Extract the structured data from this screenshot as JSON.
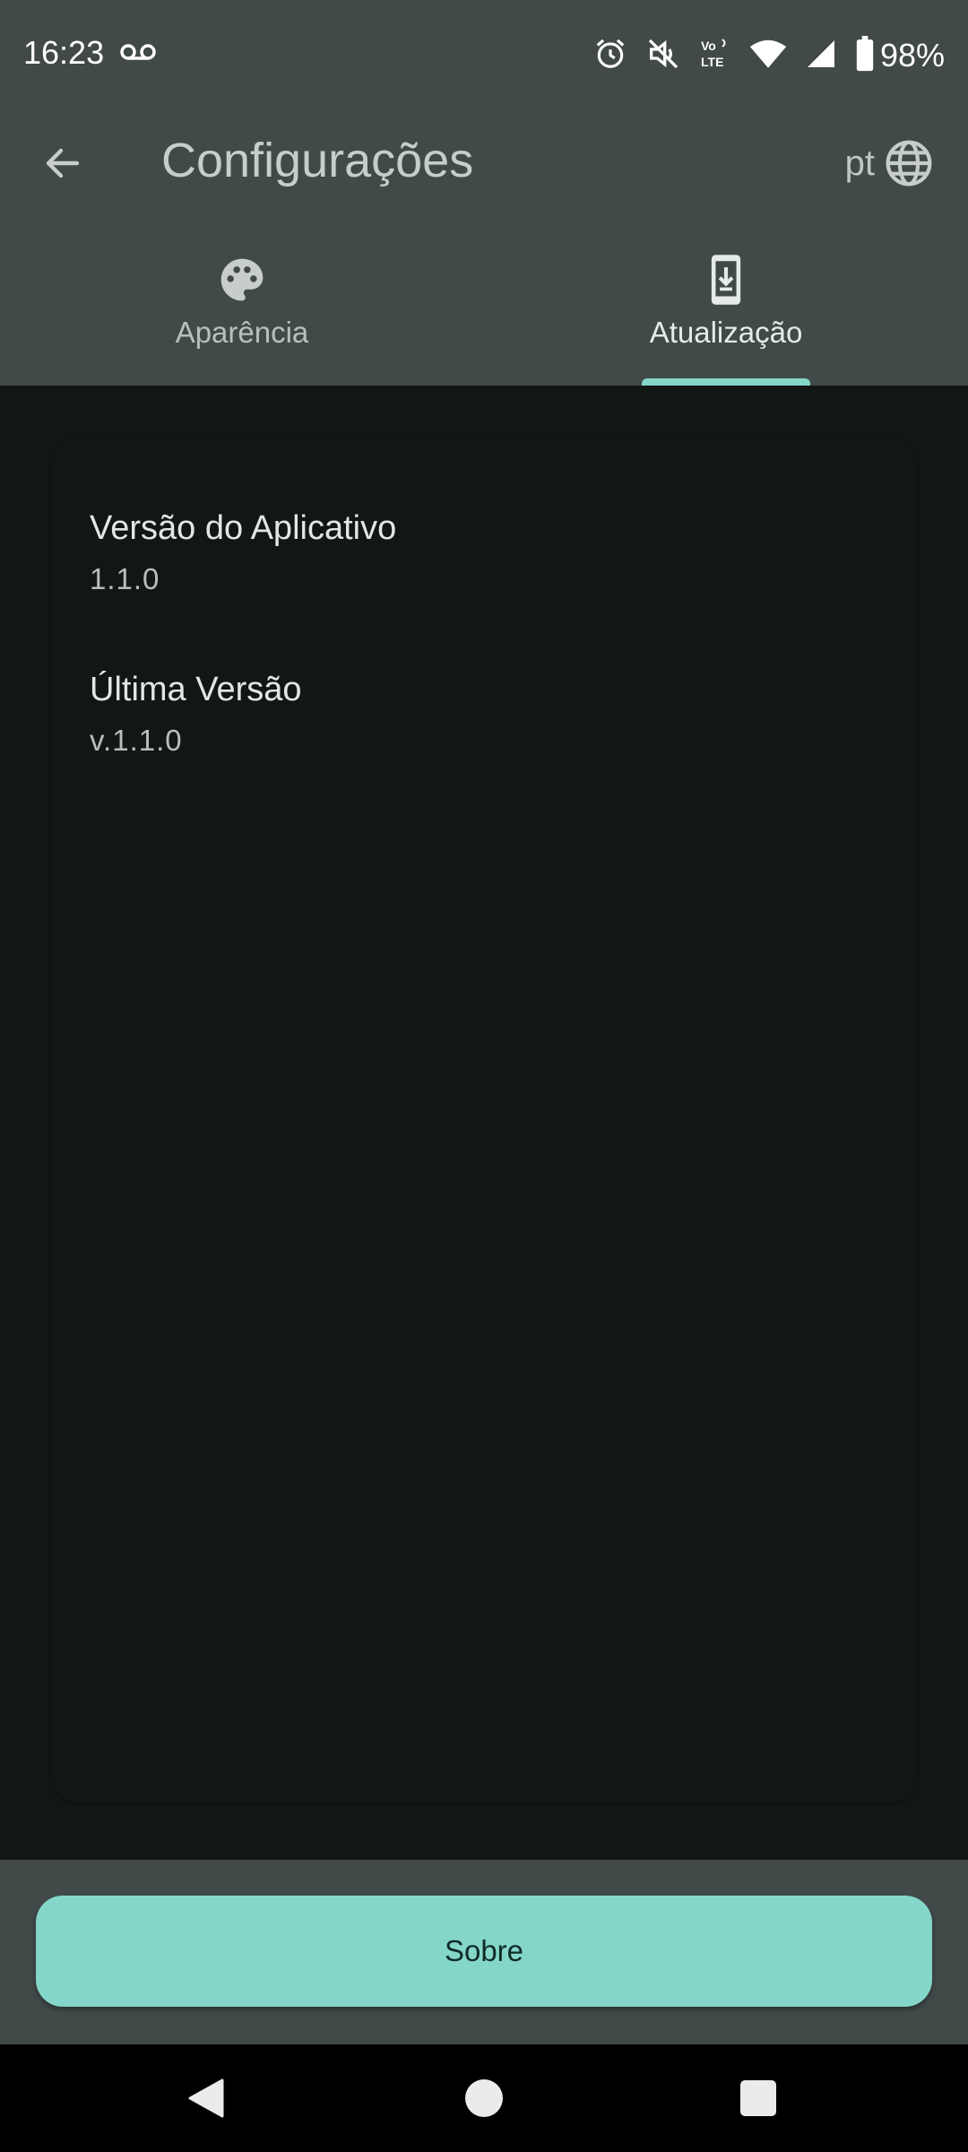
{
  "status_bar": {
    "time": "16:23",
    "battery": "98%",
    "icons": [
      "voicemail-icon",
      "alarm-icon",
      "vibrate-off-icon",
      "volte-icon",
      "wifi-icon",
      "signal-icon",
      "battery-icon"
    ]
  },
  "app_bar": {
    "title": "Configurações",
    "language": "pt",
    "back_icon": "arrow-back-icon",
    "language_icon": "globe-icon"
  },
  "tabs": [
    {
      "label": "Aparência",
      "icon": "palette-icon",
      "active": false
    },
    {
      "label": "Atualização",
      "icon": "phone-download-icon",
      "active": true
    }
  ],
  "content": {
    "items": [
      {
        "title": "Versão do Aplicativo",
        "value": "1.1.0"
      },
      {
        "title": "Última Versão",
        "value": "v.1.1.0"
      }
    ]
  },
  "bottom": {
    "about_label": "Sobre"
  },
  "colors": {
    "accent": "#84d6c9",
    "bar_background": "#414a49",
    "content_background": "#121715"
  }
}
